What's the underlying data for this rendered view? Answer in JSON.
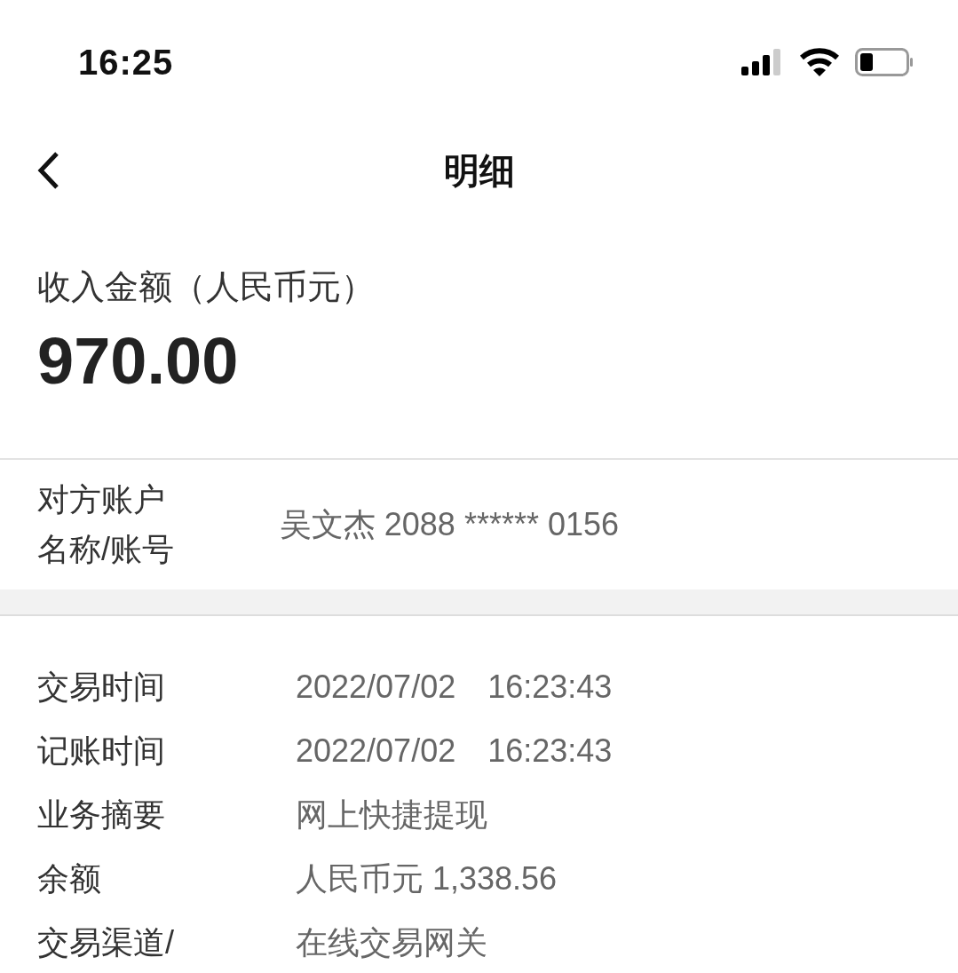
{
  "status_bar": {
    "time": "16:25"
  },
  "nav": {
    "title": "明细"
  },
  "amount": {
    "label": "收入金额（人民币元）",
    "value": "970.00"
  },
  "account": {
    "label": "对方账户名称/账号",
    "value": "吴文杰 2088 ****** 0156"
  },
  "details": [
    {
      "label": "交易时间",
      "value": "2022/07/02　16:23:43"
    },
    {
      "label": "记账时间",
      "value": "2022/07/02　16:23:43"
    },
    {
      "label": "业务摘要",
      "value": "网上快捷提现"
    },
    {
      "label": "余额",
      "value": "人民币元 1,338.56"
    },
    {
      "label": "交易渠道/",
      "value": "在线交易网关"
    }
  ]
}
